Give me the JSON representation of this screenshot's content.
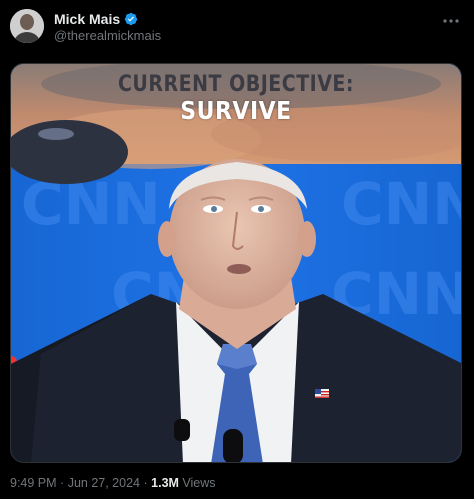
{
  "post": {
    "author": {
      "display_name": "Mick Mais",
      "handle": "@therealmickmais",
      "verified": true,
      "verified_badge_color": "#1d9bf0",
      "avatar_icon": "avatar-photo"
    },
    "more_icon": "more-options-icon",
    "media": {
      "caption_line1": "CURRENT OBJECTIVE:",
      "caption_line2": "SURVIVE",
      "background_logo_text": "CNN",
      "background_color": "#1a6ae0"
    },
    "footer": {
      "time": "9:49 PM",
      "separator": "·",
      "date": "Jun 27, 2024",
      "views_count": "1.3M",
      "views_label": "Views"
    }
  }
}
